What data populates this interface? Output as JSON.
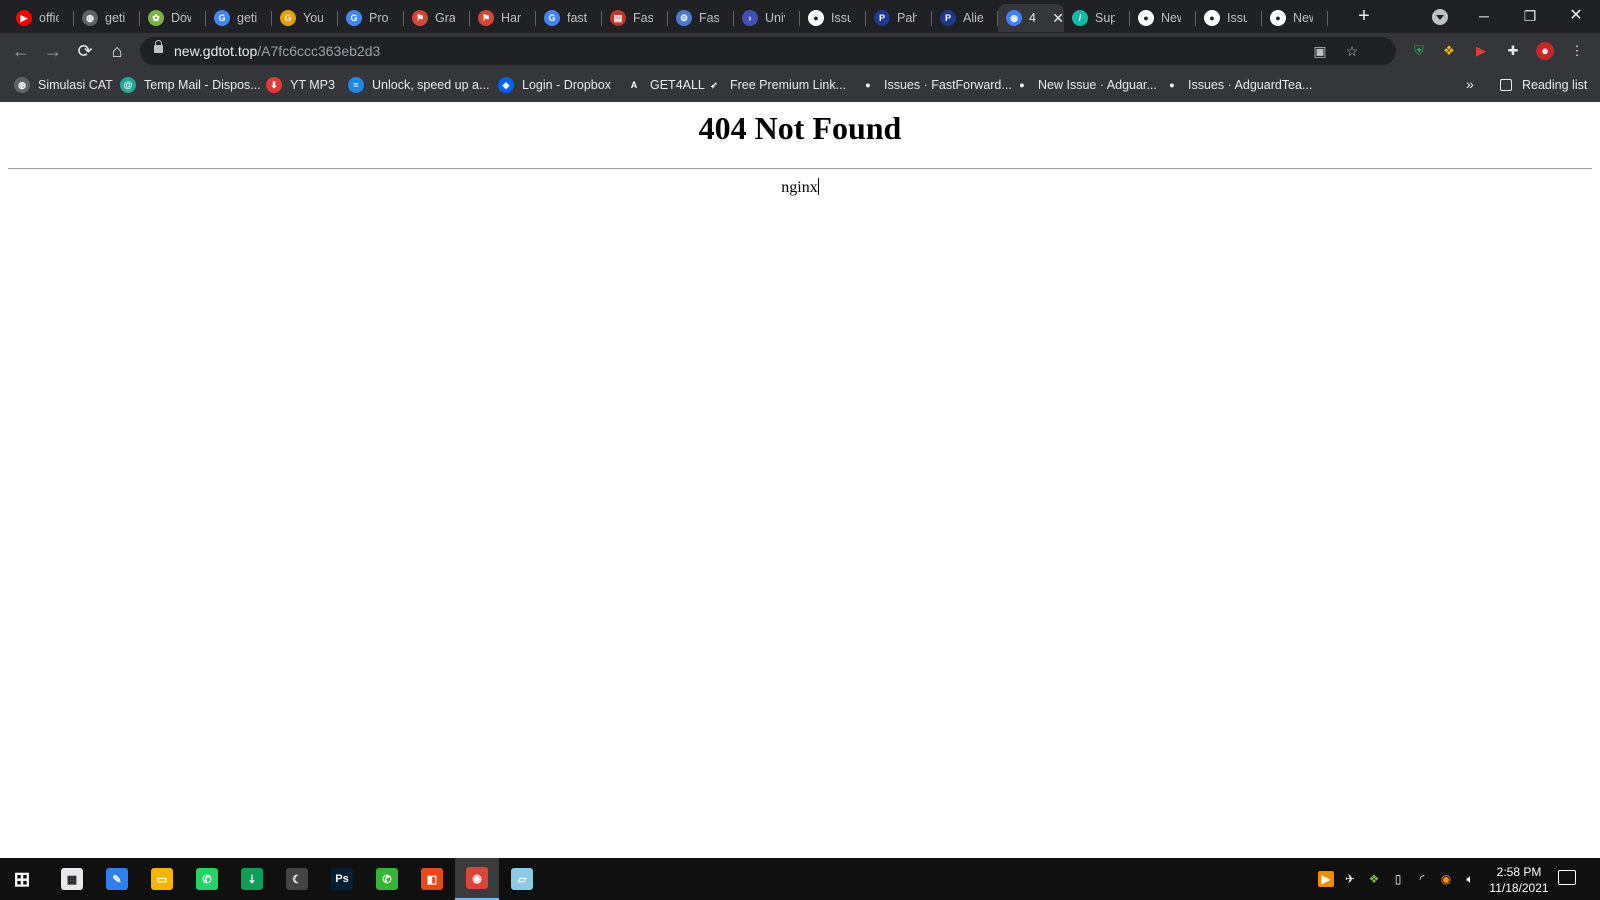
{
  "browser": {
    "tabs": [
      {
        "label": "office",
        "icon": "youtube-icon",
        "color": "#ff0000",
        "glyph": "▶"
      },
      {
        "label": "getin",
        "icon": "globe-icon",
        "color": "#5f6368",
        "glyph": "◍"
      },
      {
        "label": "Down",
        "icon": "download-site-icon",
        "color": "#7cb342",
        "glyph": "✿"
      },
      {
        "label": "getin",
        "icon": "google-icon",
        "color": "#4285f4",
        "glyph": "G"
      },
      {
        "label": "You s",
        "icon": "google-g-yellow-icon",
        "color": "#e6a100",
        "glyph": "G"
      },
      {
        "label": "Prog",
        "icon": "google-icon",
        "color": "#4285f4",
        "glyph": "G"
      },
      {
        "label": "Gran",
        "icon": "windows-flag-icon",
        "color": "#d14836",
        "glyph": "⚑"
      },
      {
        "label": "Harv",
        "icon": "windows-flag-icon",
        "color": "#d14836",
        "glyph": "⚑"
      },
      {
        "label": "fastfo",
        "icon": "google-icon",
        "color": "#4285f4",
        "glyph": "G"
      },
      {
        "label": "FastF",
        "icon": "printer-icon",
        "color": "#c0392b",
        "glyph": "▤"
      },
      {
        "label": "FastF",
        "icon": "gear-badge-icon",
        "color": "#4a7bd0",
        "glyph": "⚙"
      },
      {
        "label": "Univ",
        "icon": "chevron-right-icon",
        "color": "#3f51b5",
        "glyph": "›"
      },
      {
        "label": "Issue",
        "icon": "github-icon",
        "color": "#ffffff",
        "glyph": "●"
      },
      {
        "label": "Pahe",
        "icon": "pahe-icon",
        "color": "#1e3a8a",
        "glyph": "P"
      },
      {
        "label": "Alien",
        "icon": "pahe-icon",
        "color": "#1e3a8a",
        "glyph": "P"
      },
      {
        "label": "4",
        "icon": "gdtot-icon",
        "color": "#3b82f6",
        "glyph": "◉",
        "active": true
      },
      {
        "label": "Supe",
        "icon": "supabase-icon",
        "color": "#14b8a6",
        "glyph": "/"
      },
      {
        "label": "New",
        "icon": "github-icon",
        "color": "#ffffff",
        "glyph": "●"
      },
      {
        "label": "Issue",
        "icon": "github-icon",
        "color": "#ffffff",
        "glyph": "●"
      },
      {
        "label": "New",
        "icon": "github-icon",
        "color": "#ffffff",
        "glyph": "●"
      }
    ],
    "url_host": "new.gdtot.top",
    "url_path": "/A7fc6ccc363eb2d3"
  },
  "bookmarks": {
    "items": [
      {
        "label": "Simulasi CAT",
        "icon": "globe-icon",
        "color": "#5f6368",
        "glyph": "◍"
      },
      {
        "label": "Temp Mail - Dispos...",
        "icon": "temp-mail-icon",
        "color": "#26a69a",
        "glyph": "@"
      },
      {
        "label": "YT MP3",
        "icon": "download-arrow-icon",
        "color": "#e53935",
        "glyph": "⬇"
      },
      {
        "label": "Unlock, speed up a...",
        "icon": "wave-icon",
        "color": "#1e88e5",
        "glyph": "≈"
      },
      {
        "label": "Login - Dropbox",
        "icon": "dropbox-icon",
        "color": "#0061fe",
        "glyph": "◆"
      },
      {
        "label": "GET4ALL",
        "icon": "letter-a-icon",
        "color": "#35363a",
        "glyph": "A"
      },
      {
        "label": "Free Premium Link...",
        "icon": "rocket-icon",
        "color": "#35363a",
        "glyph": "➶"
      },
      {
        "label": "Issues · FastForward...",
        "icon": "github-icon",
        "color": "#35363a",
        "glyph": "●"
      },
      {
        "label": "New Issue · Adguar...",
        "icon": "github-icon",
        "color": "#35363a",
        "glyph": "●"
      },
      {
        "label": "Issues · AdguardTea...",
        "icon": "github-icon",
        "color": "#35363a",
        "glyph": "●"
      }
    ],
    "reading_list": "Reading list"
  },
  "page": {
    "heading": "404 Not Found",
    "server": "nginx"
  },
  "taskbar": {
    "time": "2:58 PM",
    "date": "11/18/2021",
    "apps": [
      {
        "icon": "calculator-icon",
        "color": "#e8e8e8",
        "glyph": "▦"
      },
      {
        "icon": "paint-icon",
        "color": "#2f80ed",
        "glyph": "✎"
      },
      {
        "icon": "file-explorer-icon",
        "color": "#f4b400",
        "glyph": "▭"
      },
      {
        "icon": "whatsapp-icon",
        "color": "#25d366",
        "glyph": "✆"
      },
      {
        "icon": "download-manager-icon",
        "color": "#0f9d58",
        "glyph": "⇣"
      },
      {
        "icon": "monitor-moon-icon",
        "color": "#444444",
        "glyph": "☾"
      },
      {
        "icon": "photoshop-icon",
        "color": "#001e36",
        "glyph": "Ps"
      },
      {
        "icon": "phone-app-icon",
        "color": "#35b535",
        "glyph": "✆"
      },
      {
        "icon": "office-icon",
        "color": "#e64a19",
        "glyph": "◧"
      },
      {
        "icon": "chrome-icon",
        "color": "#db4437",
        "glyph": "◉"
      },
      {
        "icon": "notepad-icon",
        "color": "#8ecae6",
        "glyph": "▱"
      }
    ]
  },
  "colors": {
    "tabstrip": "#202124",
    "toolbar": "#35363a",
    "taskbar": "#101010"
  }
}
